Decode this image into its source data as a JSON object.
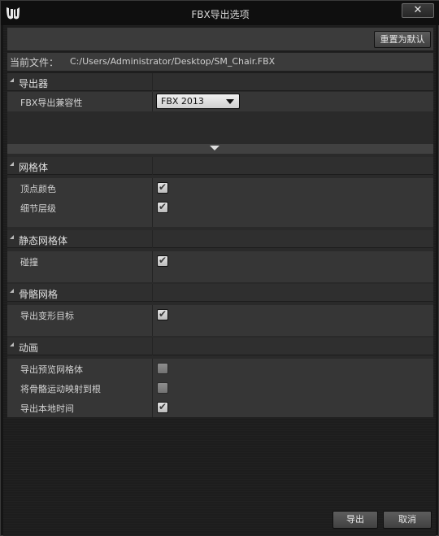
{
  "window": {
    "title": "FBX导出选项",
    "close_glyph": "✕"
  },
  "toolbar": {
    "reset_label": "重置为默认"
  },
  "file": {
    "label": "当前文件：",
    "path": "C:/Users/Administrator/Desktop/SM_Chair.FBX"
  },
  "sections": {
    "exporter": {
      "title": "导出器",
      "rows": [
        {
          "name": "FBX导出兼容性",
          "value": "FBX 2013"
        }
      ]
    },
    "mesh": {
      "title": "网格体",
      "rows": [
        {
          "name": "顶点颜色",
          "checked": true
        },
        {
          "name": "细节层级",
          "checked": true
        }
      ]
    },
    "static_mesh": {
      "title": "静态网格体",
      "rows": [
        {
          "name": "碰撞",
          "checked": true
        }
      ]
    },
    "skeletal_mesh": {
      "title": "骨骼网格",
      "rows": [
        {
          "name": "导出变形目标",
          "checked": true
        }
      ]
    },
    "animation": {
      "title": "动画",
      "rows": [
        {
          "name": "导出预览网格体",
          "checked": false
        },
        {
          "name": "将骨骼运动映射到根",
          "checked": false
        },
        {
          "name": "导出本地时间",
          "checked": true
        }
      ]
    }
  },
  "footer": {
    "export_label": "导出",
    "cancel_label": "取消"
  },
  "icons": {
    "logo": "unreal-engine-logo",
    "check": "✔",
    "expand": "chevron-down-icon",
    "collapse": "triangle-collapse-icon"
  },
  "colors": {
    "panel": "#363636",
    "header": "#2f2f2f",
    "background": "#1d1d1d"
  }
}
